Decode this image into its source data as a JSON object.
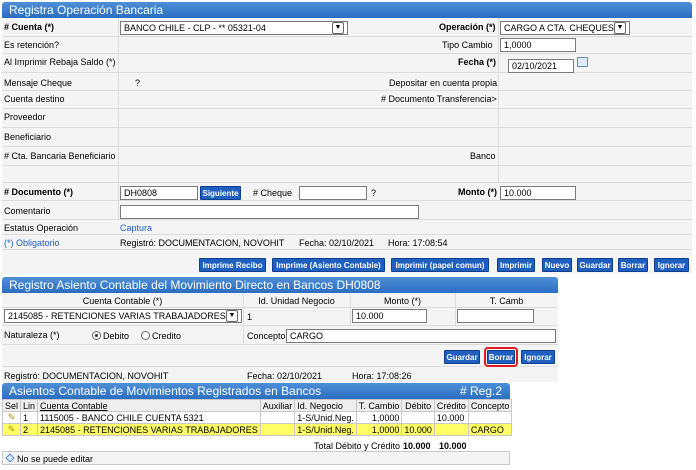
{
  "section1": {
    "title": "Registra Operación Bancaria",
    "cuenta_label": "# Cuenta (*)",
    "cuenta_value": "BANCO CHILE - CLP - ** 05321-04",
    "operacion_label": "Operación (*)",
    "operacion_value": "CARGO A CTA. CHEQUES",
    "retencion_label": "Es retención?",
    "tipo_cambio_label": "Tipo Cambio",
    "tipo_cambio_value": "1,0000",
    "rebaja_label": "Al Imprimir Rebaja Saldo (*)",
    "fecha_label": "Fecha (*)",
    "fecha_value": "02/10/2021",
    "mensaje_label": "Mensaje Cheque",
    "mensaje_q": "?",
    "depositar_label": "Depositar en cuenta propia",
    "cuenta_destino_label": "Cuenta destino",
    "doc_transf_label": "# Documento Transferencia>",
    "proveedor_label": "Proveedor",
    "beneficiario_label": "Beneficiario",
    "cta_benef_label": "# Cta. Bancaria Beneficiario",
    "banco_label": "Banco",
    "documento_label": "# Documento (*)",
    "documento_value": "DH0808",
    "siguiente_label": "Siguiente",
    "cheque_label": "# Cheque",
    "cheque_q": "?",
    "monto_label": "Monto (*)",
    "monto_value": "10.000",
    "comentario_label": "Comentario",
    "estatus_label": "Estatus Operación",
    "estatus_value": "Captura",
    "obligatorio": "(*) Obligatorio",
    "registro": "Registró: DOCUMENTACION, NOVOHIT",
    "registro_fecha": "Fecha: 02/10/2021",
    "registro_hora": "Hora: 17:08:54",
    "buttons": [
      "Imprime Recibo",
      "Imprime (Asiento Contable)",
      "Imprimir (papel comun)",
      "Imprimir",
      "Nuevo",
      "Guardar",
      "Borrar",
      "Ignorar"
    ]
  },
  "section2": {
    "title": "Registro Asiento Contable del Movimiento Directo en Bancos DH0808",
    "col_cuenta": "Cuenta Contable (*)",
    "col_unidad": "Id. Unidad Negocio",
    "col_monto": "Monto (*)",
    "col_tcamb": "T. Camb",
    "cuenta_value": "2145085 - RETENCIONES VARIAS TRABAJADORES",
    "unidad_value": "1",
    "monto_value": "10.000",
    "naturaleza_label": "Naturaleza (*)",
    "debito_label": "Debito",
    "credito_label": "Credito",
    "concepto_label": "Concepto",
    "concepto_value": "CARGO",
    "buttons": [
      "Guardar",
      "Borrar",
      "Ignorar"
    ],
    "registro": "Registró: DOCUMENTACION, NOVOHIT",
    "registro_fecha": "Fecha: 02/10/2021",
    "registro_hora": "Hora:  17:08:26"
  },
  "section3": {
    "title": "Asientos Contable de Movimientos Registrados en Bancos",
    "reg_count": "# Reg.2",
    "headers": [
      "Sel",
      "Lin",
      "Cuenta Contable",
      "Auxiliar",
      "Id. Negocio",
      "T. Cambio",
      "Débito",
      "Crédito",
      "Concepto"
    ],
    "rows": [
      {
        "lin": "1",
        "cuenta": "1115005 - BANCO CHILE CUENTA 5321",
        "auxiliar": "",
        "negocio": "1-S/Unid.Neg.",
        "tcambio": "1,0000",
        "debito": "",
        "credito": "10.000",
        "concepto": ""
      },
      {
        "lin": "2",
        "cuenta": "2145085 - RETENCIONES VARIAS TRABAJADORES",
        "auxiliar": "",
        "negocio": "1-S/Unid.Neg.",
        "tcambio": "1,0000",
        "debito": "10.000",
        "credito": "",
        "concepto": "CARGO"
      }
    ],
    "total_label": "Total Débito y Crédito",
    "total_debito": "10.000",
    "total_credito": "10.000",
    "no_edit": "No se puede editar",
    "colors": {
      "highlight_row": "#ffff66",
      "accent": "#1f5fbf"
    }
  }
}
